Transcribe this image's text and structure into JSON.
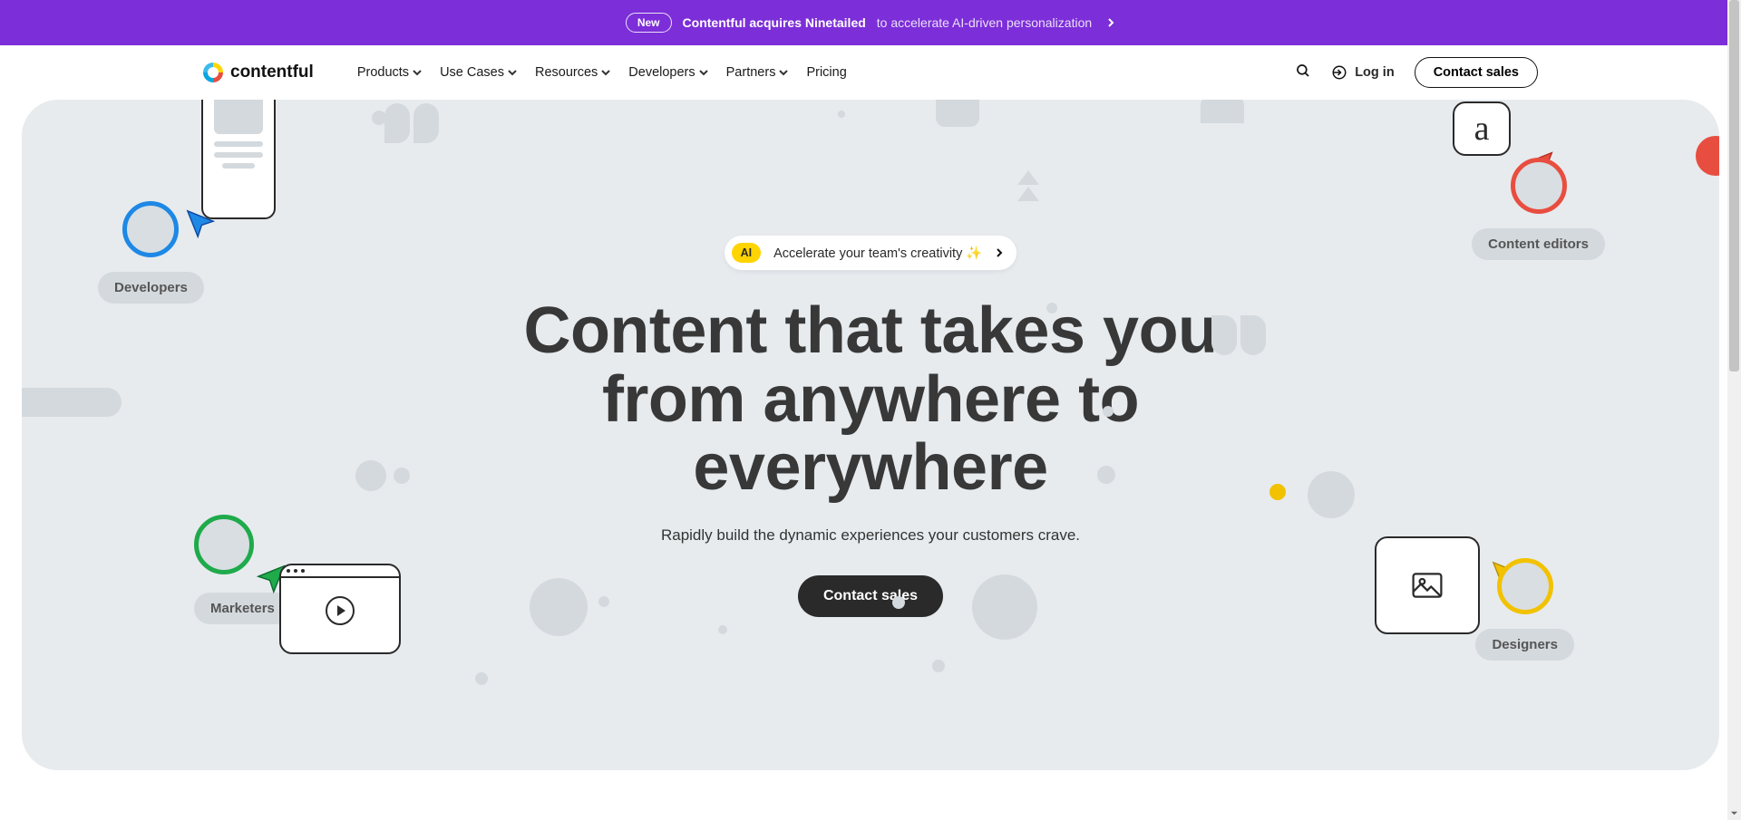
{
  "banner": {
    "pill": "New",
    "headline": "Contentful acquires Ninetailed",
    "sub": "to accelerate AI-driven personalization"
  },
  "brand": {
    "name": "contentful"
  },
  "nav": {
    "items": [
      {
        "label": "Products",
        "dropdown": true
      },
      {
        "label": "Use Cases",
        "dropdown": true
      },
      {
        "label": "Resources",
        "dropdown": true
      },
      {
        "label": "Developers",
        "dropdown": true
      },
      {
        "label": "Partners",
        "dropdown": true
      },
      {
        "label": "Pricing",
        "dropdown": false
      }
    ],
    "login": "Log in",
    "cta": "Contact sales"
  },
  "hero": {
    "ai_badge": "AI",
    "ai_text": "Accelerate your team's creativity ✨",
    "headline": "Content that takes you from anywhere to everywhere",
    "subhead": "Rapidly build the dynamic experiences your customers crave.",
    "cta": "Contact sales"
  },
  "personas": {
    "developers": "Developers",
    "editors": "Content editors",
    "marketers": "Marketers",
    "designers": "Designers"
  },
  "letterbox": {
    "char": "a"
  },
  "colors": {
    "banner": "#7c2ed8",
    "hero_bg": "#e7ebee",
    "ai_badge": "#ffd400",
    "dev_ring": "#1e88e5",
    "editor_ring": "#e84e40",
    "marketer_ring": "#1faa4b",
    "designer_ring": "#f2c200"
  }
}
